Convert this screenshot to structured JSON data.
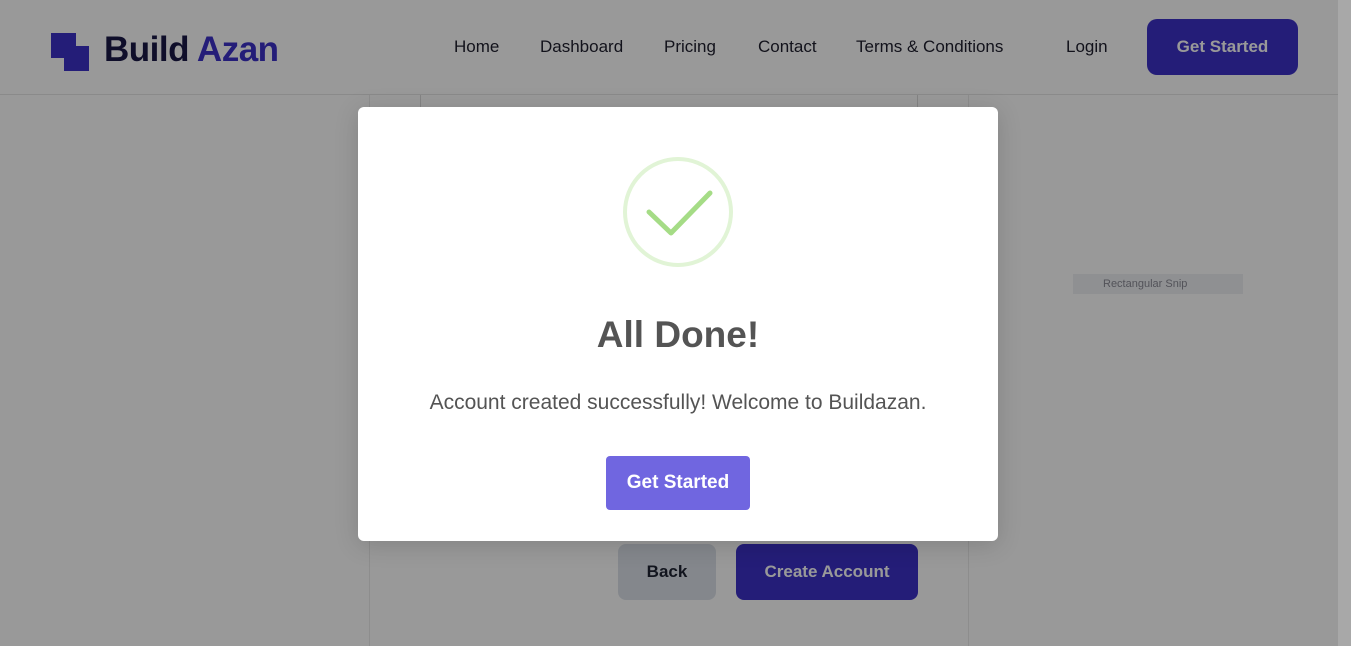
{
  "navbar": {
    "brand_part1": "Build",
    "brand_part2": "Azan",
    "links": [
      "Home",
      "Dashboard",
      "Pricing",
      "Contact",
      "Terms & Conditions"
    ],
    "login": "Login",
    "cta": "Get Started"
  },
  "form": {
    "back_label": "Back",
    "create_label": "Create Account"
  },
  "snip_tooltip": "Rectangular Snip",
  "modal": {
    "icon": "check-circle-icon",
    "title": "All Done!",
    "message": "Account created successfully! Welcome to Buildazan.",
    "button_label": "Get Started"
  },
  "colors": {
    "brand_primary": "#3d31c9",
    "brand_dark": "#1a1846",
    "modal_button": "#7066e0",
    "success_green": "#a5dc86",
    "success_ring": "#e1f4d6",
    "modal_text": "#545454",
    "back_button": "#dde2ea"
  }
}
